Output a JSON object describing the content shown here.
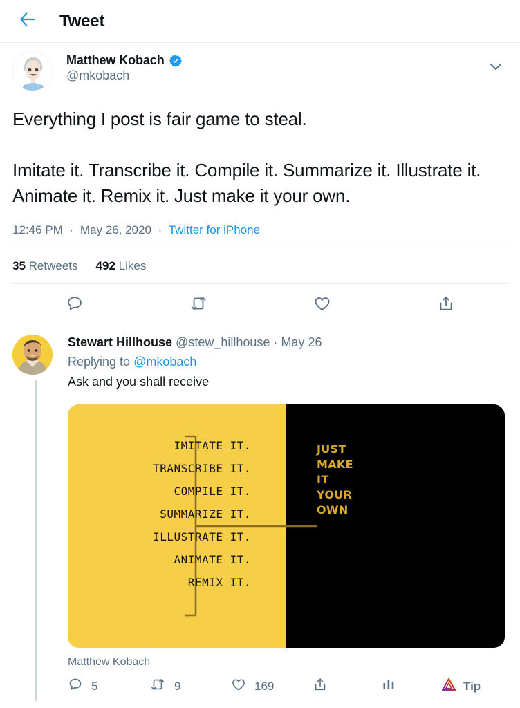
{
  "header": {
    "back_icon": "arrow-left-icon",
    "title": "Tweet"
  },
  "tweet": {
    "author": {
      "display_name": "Matthew Kobach",
      "handle": "@mkobach",
      "verified": true,
      "avatar_alt": "cartoon-avatar"
    },
    "caret_icon": "chevron-down-icon",
    "text": "Everything I post is fair game to steal.\n\nImitate it. Transcribe it. Compile it. Summarize it. Illustrate it. Animate it. Remix it. Just make it your own.",
    "time": "12:46 PM",
    "date": "May 26, 2020",
    "client": "Twitter for iPhone",
    "separator": "·",
    "stats": {
      "retweet_count": "35",
      "retweet_label": "Retweets",
      "like_count": "492",
      "like_label": "Likes"
    },
    "actions": [
      {
        "name": "reply-icon",
        "label": ""
      },
      {
        "name": "retweet-icon",
        "label": ""
      },
      {
        "name": "like-icon",
        "label": ""
      },
      {
        "name": "share-icon",
        "label": ""
      }
    ]
  },
  "reply": {
    "author": {
      "display_name": "Stewart Hillhouse",
      "handle": "@stew_hillhouse",
      "avatar_alt": "photo-avatar"
    },
    "date": "May 26",
    "separator": "·",
    "replying_prefix": "Replying to",
    "replying_to": "@mkobach",
    "text": "Ask and you shall receive",
    "caret_icon": "chevron-down-icon",
    "media": {
      "credit": "Matthew Kobach",
      "left_bg": "#F7CE48",
      "right_bg": "#000000",
      "ink": "#141414",
      "gold": "#8A6D1F",
      "right_ink": "#D8A92A",
      "left_items": [
        "IMITATE IT.",
        "TRANSCRIBE IT.",
        "COMPILE IT.",
        "SUMMARIZE IT.",
        "ILLUSTRATE IT.",
        "ANIMATE IT.",
        "REMIX IT."
      ],
      "right_lines": [
        "JUST",
        "MAKE",
        "IT",
        "YOUR",
        "OWN"
      ]
    },
    "actions": {
      "reply_count": "5",
      "retweet_count": "9",
      "like_count": "169",
      "share_icon": "share-icon",
      "analytics_icon": "analytics-bars-icon",
      "tip_icon": "bat-triangle-icon",
      "tip_label": "Tip"
    }
  },
  "colors": {
    "accent": "#1b95e0",
    "muted": "#5b7083",
    "text": "#0f1419",
    "border": "#ebeef0",
    "yellow": "#F7CE48"
  }
}
